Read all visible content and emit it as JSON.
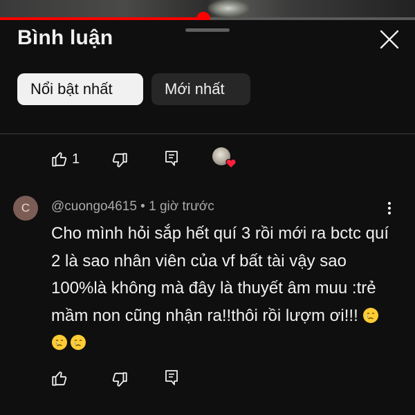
{
  "video": {
    "progress_fraction": 0.49
  },
  "comments_panel": {
    "title": "Bình luận",
    "close_icon": "close-icon"
  },
  "sort_chips": [
    {
      "label": "Nổi bật nhất",
      "selected": true
    },
    {
      "label": "Mới nhất",
      "selected": false
    }
  ],
  "previous_comment_actions": {
    "like_icon": "thumbs-up-icon",
    "like_count": "1",
    "dislike_icon": "thumbs-down-icon",
    "reply_icon": "reply-icon",
    "creator_heart_icon": "creator-heart-icon"
  },
  "comment": {
    "avatar_letter": "C",
    "author": "@cuongo4615",
    "separator": "•",
    "time": "1 giờ trước",
    "text": "Cho mình hỏi sắp hết quí 3 rồi mới ra bctc quí 2 là sao nhân viên của vf bất tài vậy sao 100%là không mà đây là thuyết âm muu :trẻ mầm non cũng nhận ra!!thôi rồi lượm ơi!!!",
    "emoji_icons": [
      "crying-face-emoji",
      "crying-face-emoji",
      "crying-face-emoji"
    ],
    "menu_icon": "more-vert-icon",
    "like_icon": "thumbs-up-icon",
    "dislike_icon": "thumbs-down-icon",
    "reply_icon": "reply-icon"
  },
  "colors": {
    "background": "#0f0f0f",
    "accent_red": "#ff0000",
    "chip_selected_bg": "#f1f1f1",
    "chip_bg": "#272727",
    "avatar_bg": "#7b5d55",
    "secondary_text": "#aaaaaa"
  }
}
